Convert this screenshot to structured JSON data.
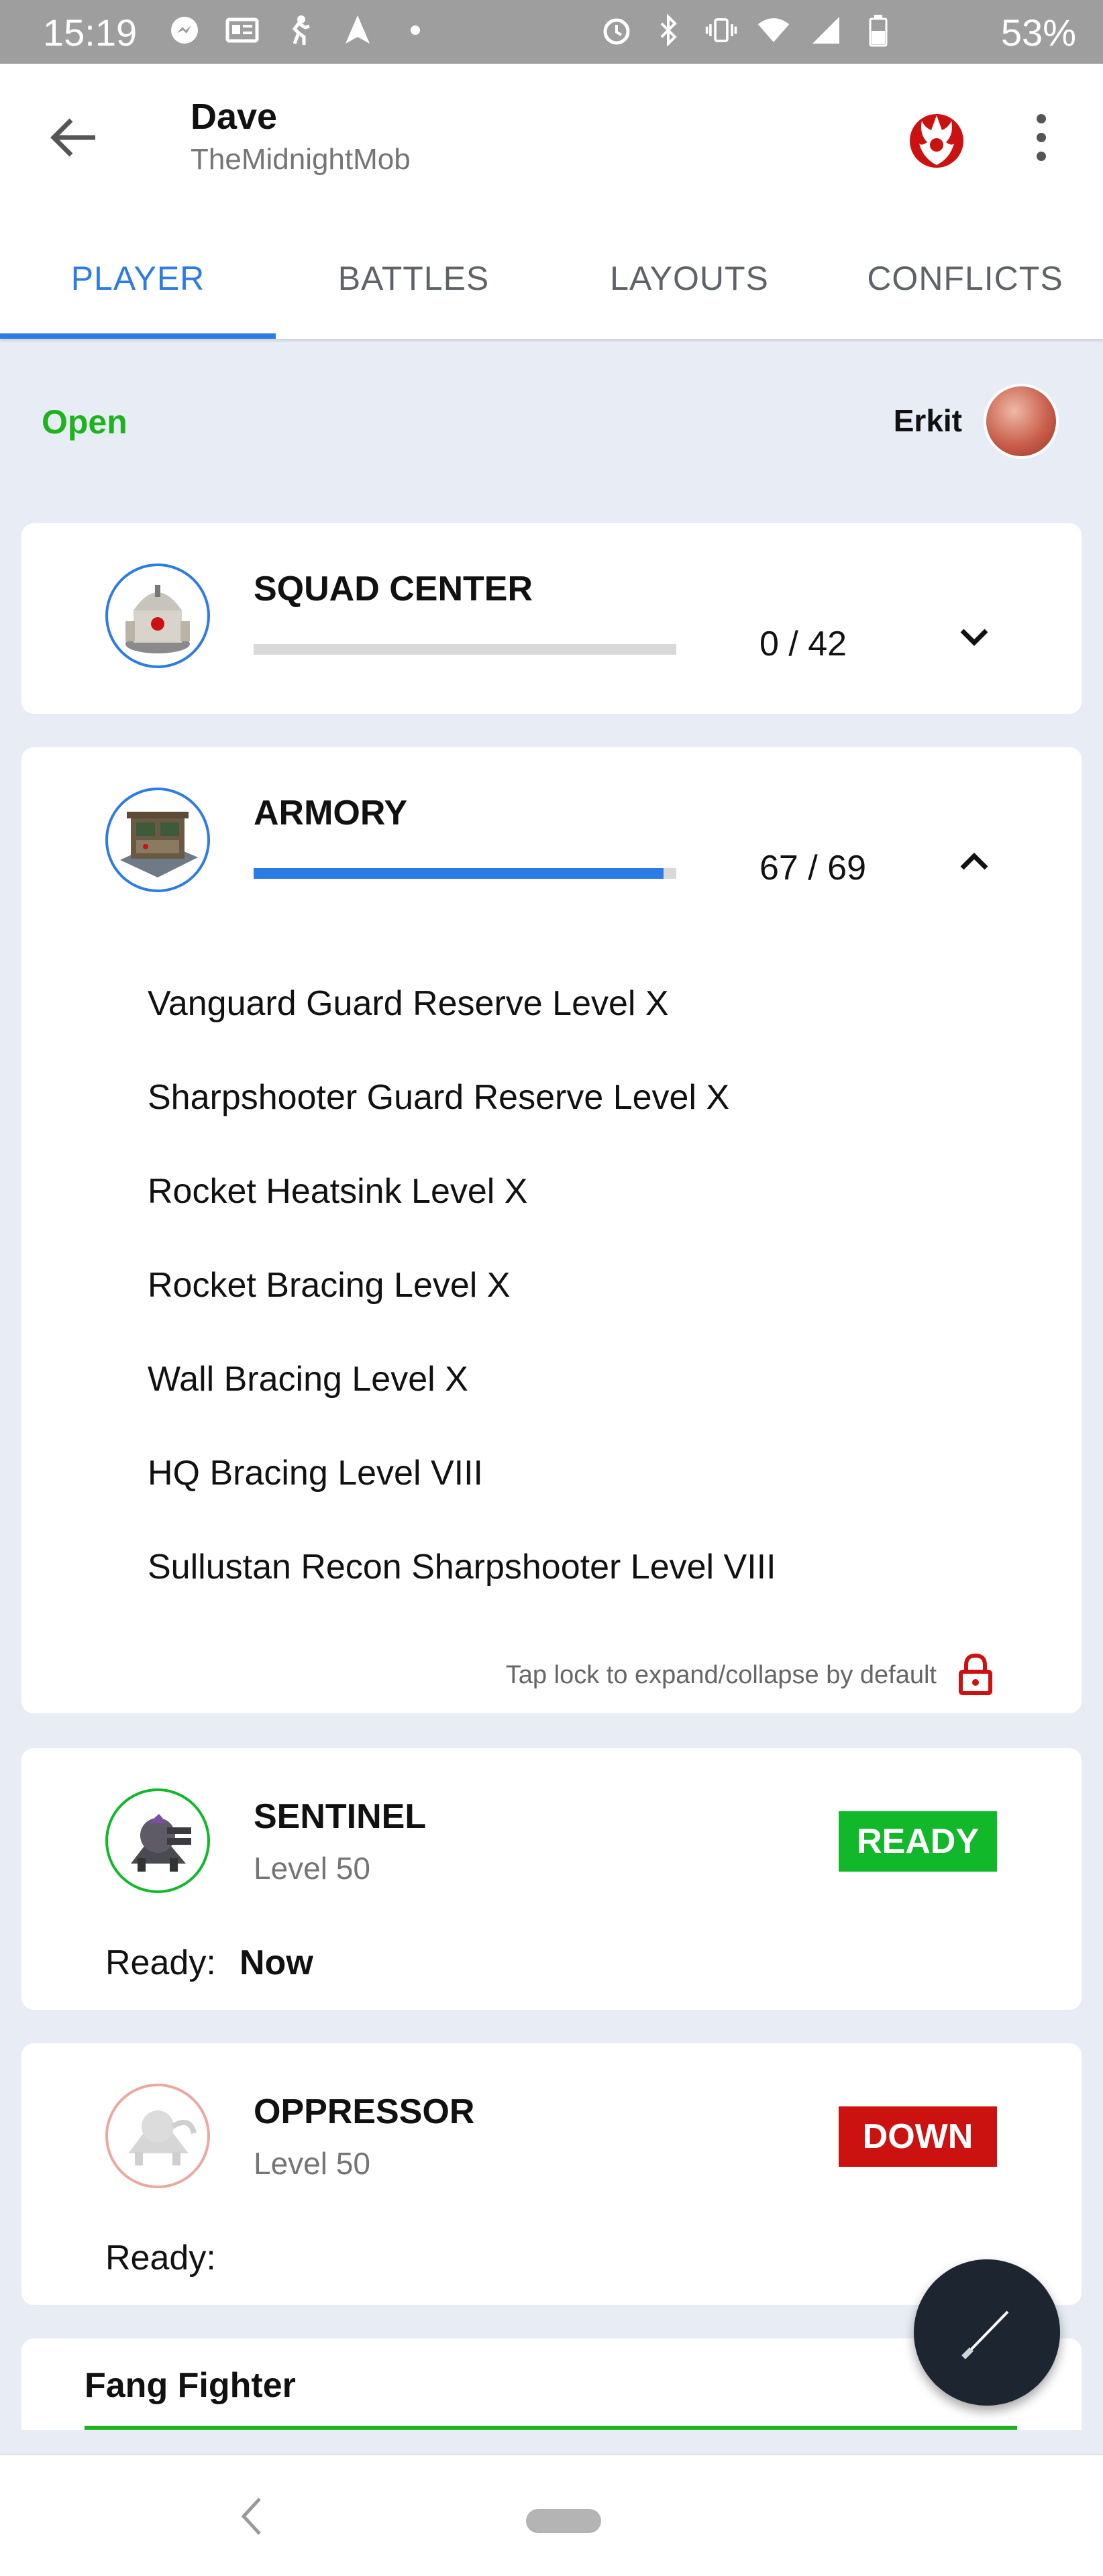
{
  "status_bar": {
    "time": "15:19",
    "battery": "53%"
  },
  "header": {
    "title": "Dave",
    "subtitle": "TheMidnightMob"
  },
  "tabs": [
    {
      "label": "PLAYER",
      "active": true
    },
    {
      "label": "BATTLES",
      "active": false
    },
    {
      "label": "LAYOUTS",
      "active": false
    },
    {
      "label": "CONFLICTS",
      "active": false
    }
  ],
  "status": {
    "open_label": "Open",
    "player_name": "Erkit"
  },
  "buildings": [
    {
      "name": "SQUAD CENTER",
      "count": "0 / 42",
      "progress": 0,
      "expanded": false
    },
    {
      "name": "ARMORY",
      "count": "67 / 69",
      "progress": 0.97,
      "expanded": true,
      "upgrades": [
        "Vanguard Guard Reserve Level X",
        "Sharpshooter Guard Reserve Level X",
        "Rocket Heatsink Level X",
        "Rocket Bracing Level X",
        "Wall Bracing Level X",
        "HQ Bracing Level VIII",
        "Sullustan Recon Sharpshooter Level VIII"
      ],
      "lock_hint": "Tap lock to expand/collapse by default"
    }
  ],
  "units": [
    {
      "name": "SENTINEL",
      "level": "Level 50",
      "status": "READY",
      "status_color": "#11b82a",
      "ready_label": "Ready:",
      "ready_value": "Now"
    },
    {
      "name": "OPPRESSOR",
      "level": "Level 50",
      "status": "DOWN",
      "status_color": "#cc1111",
      "ready_label": "Ready:",
      "ready_value": ""
    }
  ],
  "fang": {
    "label": "Fang Fighter"
  },
  "colors": {
    "accent": "#2d7be5",
    "open_green": "#1eb31e",
    "rebel_red": "#cc1111"
  },
  "icons": {
    "back": "arrow-left-icon",
    "faction": "rebel-alliance-icon",
    "more": "more-vert-icon",
    "lock": "lock-icon",
    "fab": "lightsaber-edit-icon"
  }
}
